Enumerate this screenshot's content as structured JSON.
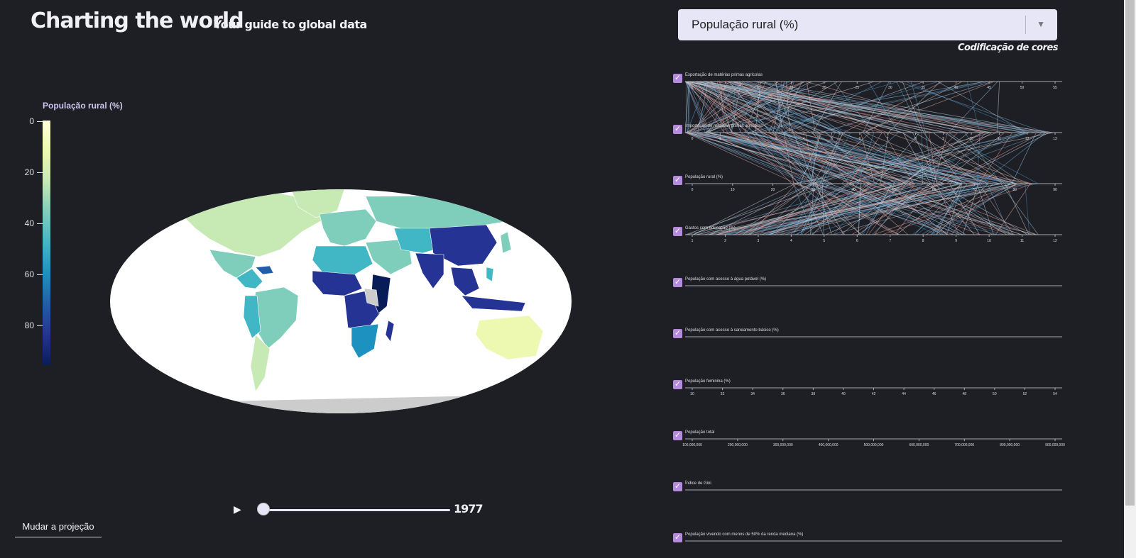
{
  "header": {
    "title": "Charting the world",
    "subtitle": "Your guide to global data"
  },
  "indicator_select": {
    "value": "População rural (%)"
  },
  "color_coding_label": "Codificação de cores",
  "legend": {
    "title": "População rural (%)",
    "ticks": [
      "0",
      "20",
      "40",
      "60",
      "80"
    ],
    "colors": [
      "#ffffd9",
      "#edf8b1",
      "#c7e9b4",
      "#7fcdbb",
      "#41b6c4",
      "#1d91c0",
      "#225ea8",
      "#253494",
      "#081d58"
    ]
  },
  "timeline": {
    "year": "1977"
  },
  "projection_button": "Mudar a projeção",
  "parallel_axes": [
    {
      "label": "Exportação de matérias primas agrícolas",
      "ticks": [
        "0",
        "5",
        "10",
        "15",
        "20",
        "25",
        "30",
        "35",
        "40",
        "45",
        "50",
        "55"
      ]
    },
    {
      "label": "Importação de matérias primas agrícolas",
      "ticks": [
        "0",
        "1",
        "2",
        "3",
        "4",
        "5",
        "6",
        "7",
        "8",
        "9",
        "10",
        "11",
        "12",
        "13"
      ]
    },
    {
      "label": "População rural (%)",
      "ticks": [
        "0",
        "10",
        "20",
        "30",
        "40",
        "50",
        "60",
        "70",
        "80",
        "90"
      ]
    },
    {
      "label": "Gastos com educação (%)",
      "ticks": [
        "1",
        "2",
        "3",
        "4",
        "5",
        "6",
        "7",
        "8",
        "9",
        "10",
        "11",
        "12"
      ]
    },
    {
      "label": "População com acesso à água potável (%)",
      "ticks": []
    },
    {
      "label": "População com acesso à saneamento básico (%)",
      "ticks": []
    },
    {
      "label": "População feminina (%)",
      "ticks": [
        "30",
        "32",
        "34",
        "36",
        "38",
        "40",
        "42",
        "44",
        "46",
        "48",
        "50",
        "52",
        "54"
      ]
    },
    {
      "label": "População total",
      "ticks": [
        "100,000,000",
        "200,000,000",
        "300,000,000",
        "400,000,000",
        "500,000,000",
        "600,000,000",
        "700,000,000",
        "800,000,000",
        "900,000,000"
      ]
    },
    {
      "label": "Índice de Gini",
      "ticks": []
    },
    {
      "label": "População vivendo com menos de 50% da renda mediana (%)",
      "ticks": []
    }
  ]
}
